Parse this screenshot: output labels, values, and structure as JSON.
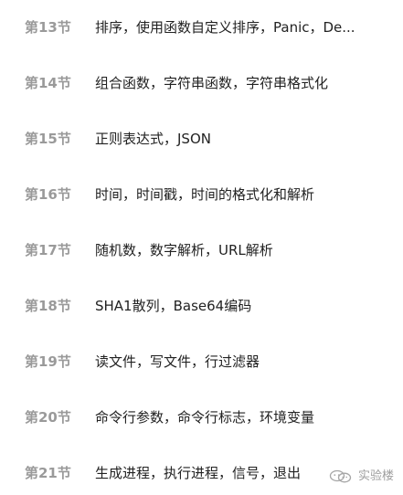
{
  "lessons": [
    {
      "number": "第13节",
      "title": "排序，使用函数自定义排序，Panic，De..."
    },
    {
      "number": "第14节",
      "title": "组合函数，字符串函数，字符串格式化"
    },
    {
      "number": "第15节",
      "title": "正则表达式，JSON"
    },
    {
      "number": "第16节",
      "title": "时间，时间戳，时间的格式化和解析"
    },
    {
      "number": "第17节",
      "title": "随机数，数字解析，URL解析"
    },
    {
      "number": "第18节",
      "title": "SHA1散列，Base64编码"
    },
    {
      "number": "第19节",
      "title": "读文件，写文件，行过滤器"
    },
    {
      "number": "第20节",
      "title": "命令行参数，命令行标志，环境变量"
    },
    {
      "number": "第21节",
      "title": "生成进程，执行进程，信号，退出"
    }
  ],
  "watermark": {
    "icon": "wechat-icon",
    "text": "实验楼"
  },
  "colors": {
    "number": "#9a9a9a",
    "title": "#222222",
    "watermark": "#9f9f9f",
    "background": "#ffffff"
  }
}
